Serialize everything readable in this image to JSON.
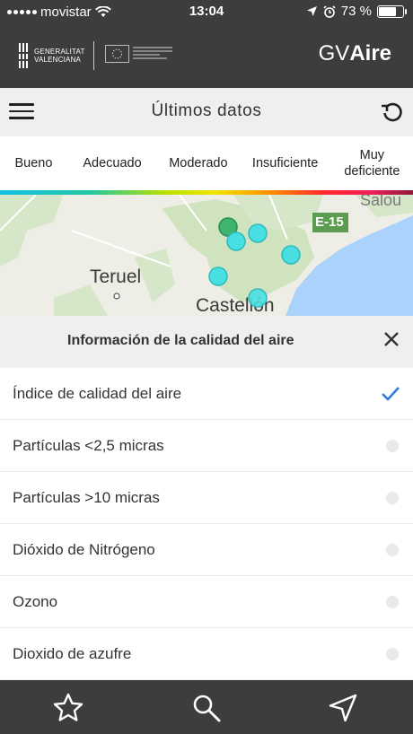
{
  "status_bar": {
    "carrier": "movistar",
    "time": "13:04",
    "battery": "73 %",
    "battery_level": 73
  },
  "header": {
    "org_line1": "GENERALITAT",
    "org_line2": "VALENCIANA",
    "brand_prefix": "GV",
    "brand_suffix": "Aire"
  },
  "toolbar": {
    "title": "Últimos datos",
    "menu_icon": "hamburger-menu-icon",
    "refresh_icon": "refresh-icon"
  },
  "legend": {
    "items": [
      "Bueno",
      "Adecuado",
      "Moderado",
      "Insuficiente",
      "Muy deficiente"
    ],
    "colors": [
      "#12bfe6",
      "#23c8a0",
      "#f1e400",
      "#ff8a00",
      "#8b1a3b"
    ]
  },
  "map": {
    "labels": {
      "teruel": "Teruel",
      "castellon": "Castellón",
      "salou": "Salou",
      "road": "E-15"
    },
    "station_color": "#48dfe2",
    "station_good_color": "#3db56f",
    "road_color": "#5c9c50"
  },
  "panel": {
    "title": "Información de la calidad del aire",
    "options": [
      {
        "label": "Índice de calidad del aire",
        "selected": true
      },
      {
        "label": "Partículas <2,5 micras",
        "selected": false
      },
      {
        "label": "Partículas >10 micras",
        "selected": false
      },
      {
        "label": "Dióxido de Nitrógeno",
        "selected": false
      },
      {
        "label": "Ozono",
        "selected": false
      },
      {
        "label": "Dioxido de azufre",
        "selected": false
      }
    ]
  },
  "tabbar": {
    "items": [
      "star-icon",
      "search-icon",
      "navigation-arrow-icon"
    ]
  },
  "colors": {
    "dark": "#3d3d3d",
    "check": "#2e7de0"
  }
}
